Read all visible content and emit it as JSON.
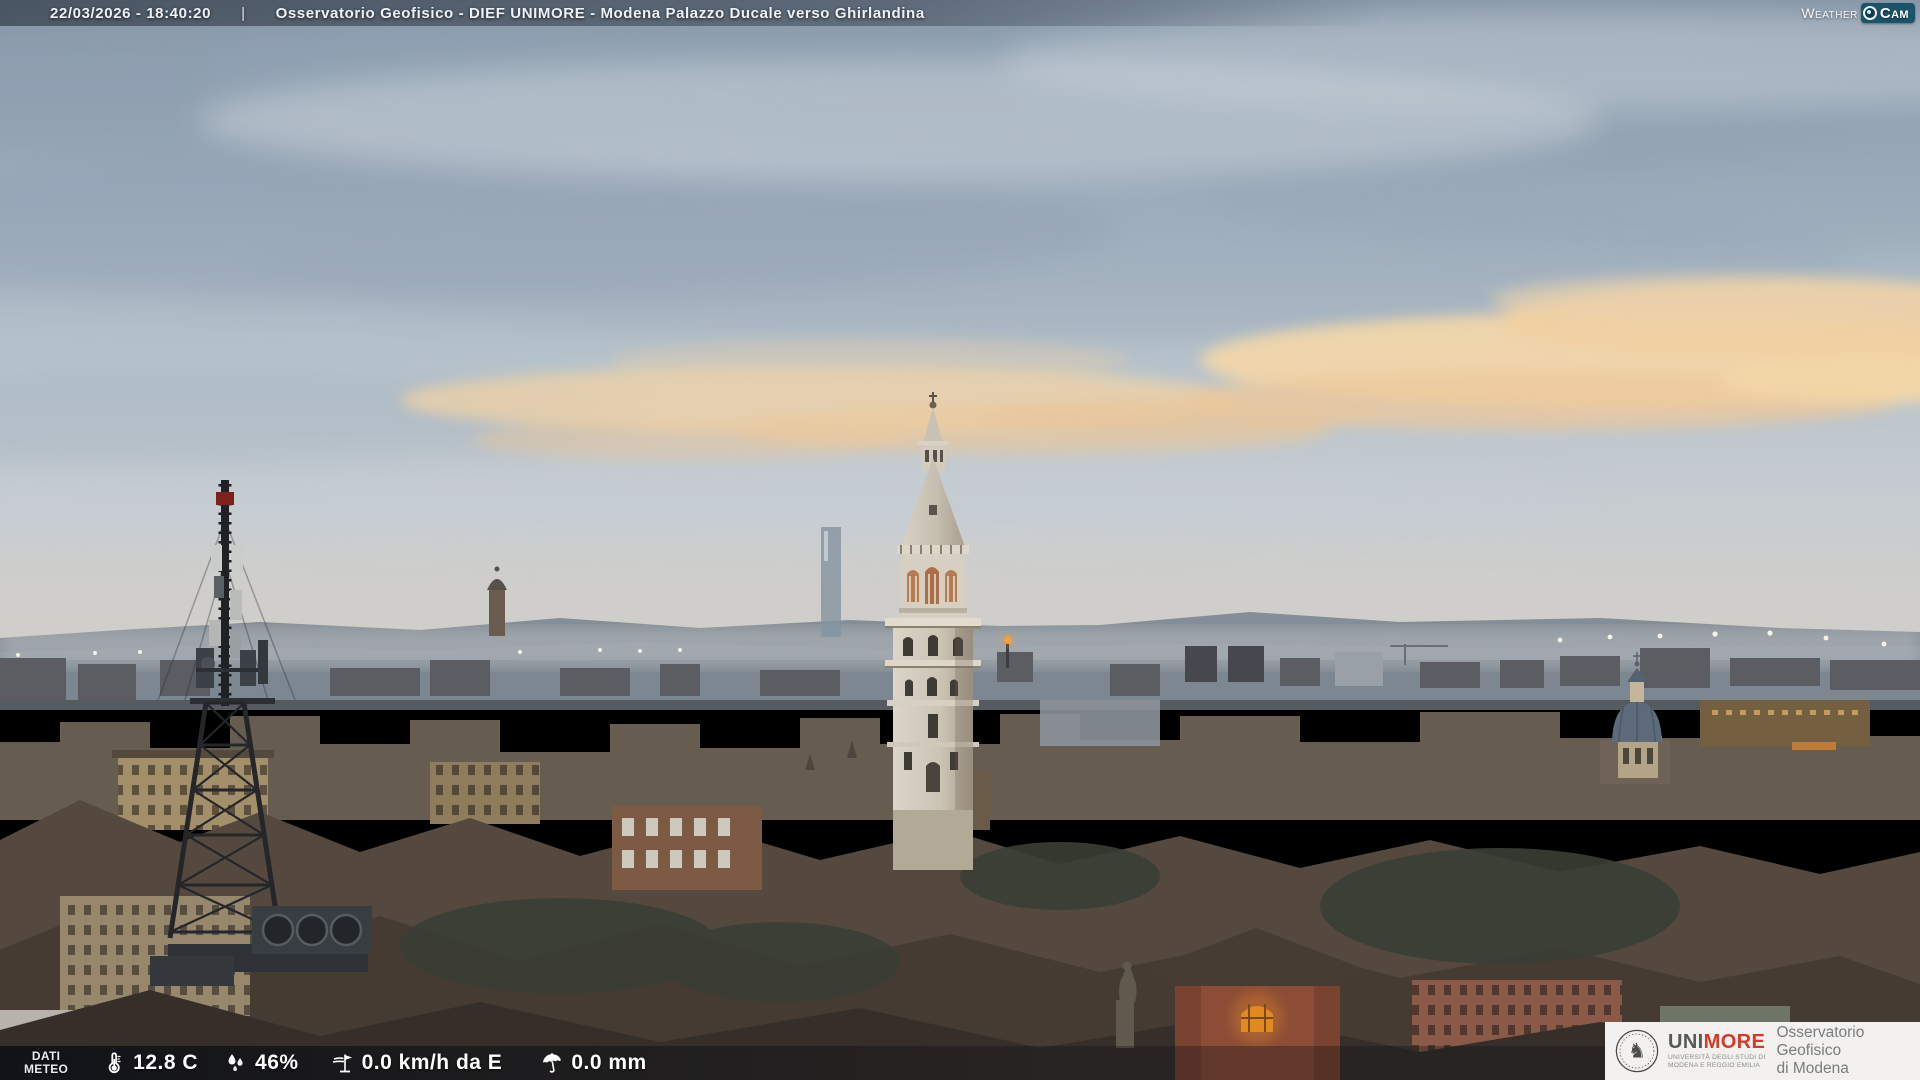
{
  "header": {
    "timestamp": "22/03/2026 - 18:40:20",
    "separator": "|",
    "title": "Osservatorio Geofisico - DIEF UNIMORE - Modena Palazzo Ducale verso Ghirlandina"
  },
  "watermark": {
    "weather": "Weather",
    "cam": "Cam",
    "badge_color": "#1a536a",
    "icon": "camera-lens-icon"
  },
  "weather_bar": {
    "label_line1": "DATI",
    "label_line2": "METEO",
    "temperature": "12.8 C",
    "humidity": "46%",
    "wind": "0.0 km/h da E",
    "rain": "0.0 mm",
    "icons": [
      "thermometer-icon",
      "water-drops-icon",
      "wind-vane-icon",
      "umbrella-icon"
    ]
  },
  "unimore_box": {
    "uni": "UNI",
    "more": "MORE",
    "dept_line1": "UNIVERSITÀ DEGLI STUDI DI",
    "dept_line2": "MODENA E REGGIO EMILIA",
    "org_line1": "Osservatorio Geofisico",
    "org_line2": "di Modena",
    "brand_red": "#d03c28",
    "seal_icon": "university-seal-icon"
  }
}
